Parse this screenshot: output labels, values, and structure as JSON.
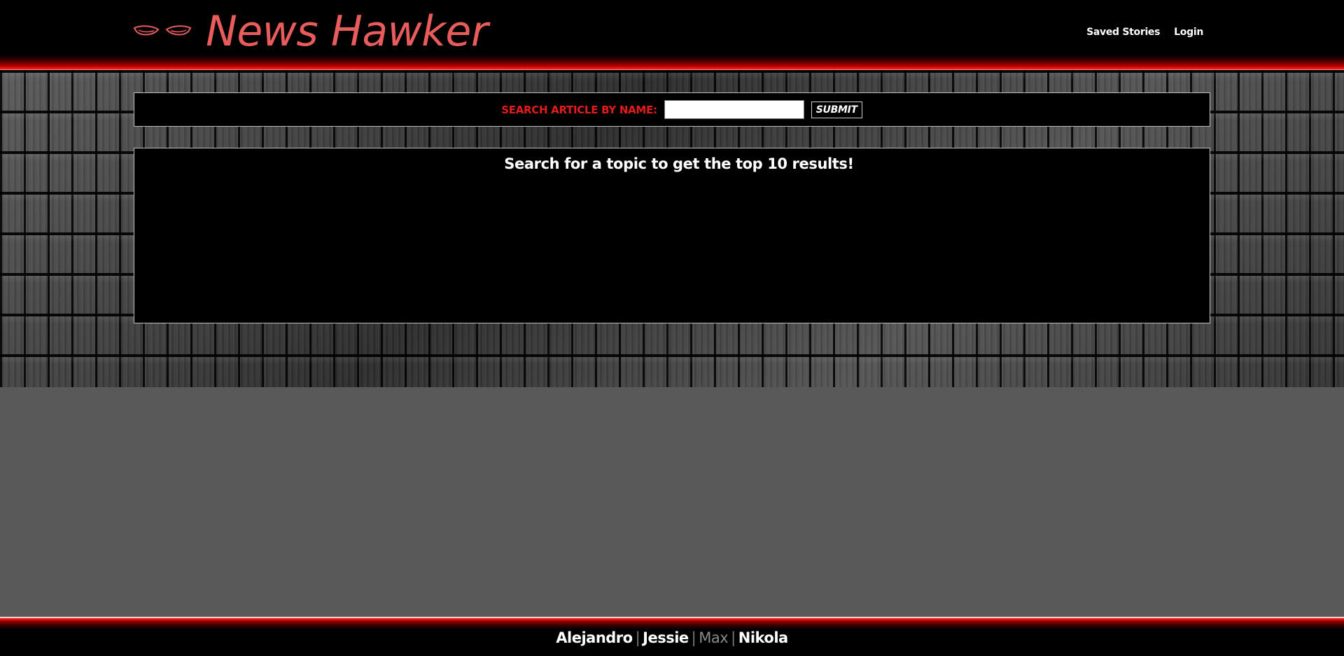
{
  "header": {
    "brand": "News Hawker",
    "logo_icon": "wings-icon",
    "nav": {
      "saved_stories": "Saved Stories",
      "login": "Login"
    }
  },
  "search": {
    "label": "SEARCH ARTICLE BY NAME:",
    "value": "",
    "placeholder": "",
    "submit_label": "SUBMIT"
  },
  "results": {
    "message": "Search for a topic to get the top 10 results!"
  },
  "footer": {
    "credits": [
      {
        "name": "Alejandro"
      },
      {
        "name": "Jessie"
      },
      {
        "name": "Max"
      },
      {
        "name": "Nikola"
      }
    ],
    "separator": "|"
  },
  "colors": {
    "brand": "#e85c5c",
    "accent_red": "#e51c1c",
    "page_background": "#595959"
  }
}
